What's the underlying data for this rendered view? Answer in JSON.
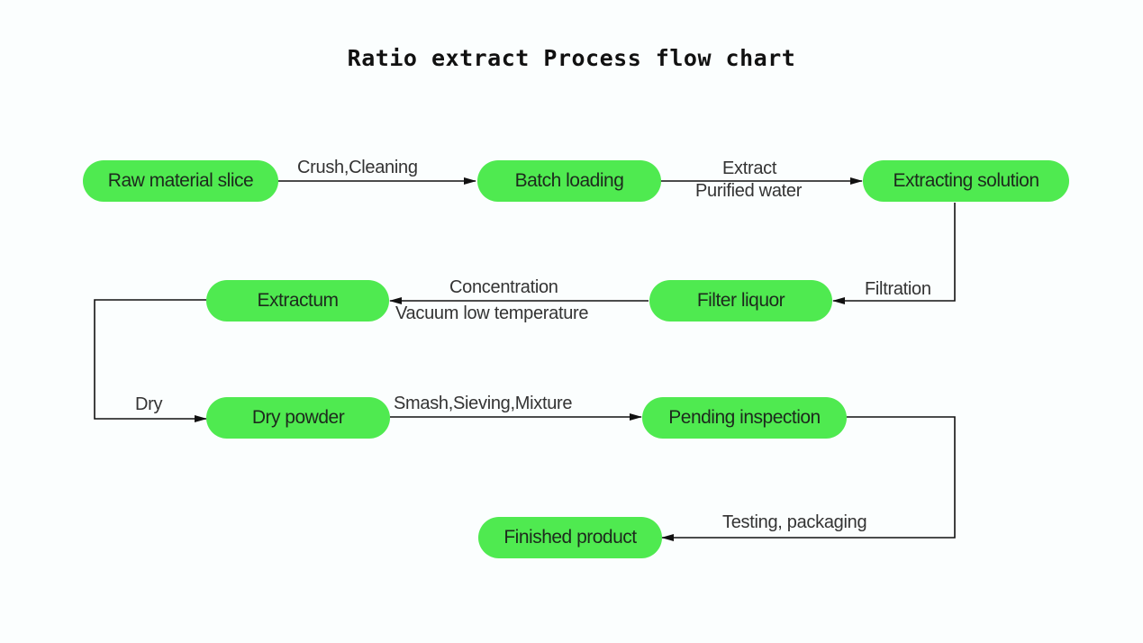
{
  "title": "Ratio extract Process flow chart",
  "colors": {
    "node_fill": "#4fea50",
    "line": "#111111",
    "background": "#fbfefe"
  },
  "nodes": [
    {
      "id": "raw",
      "label": "Raw material slice"
    },
    {
      "id": "batch",
      "label": "Batch loading"
    },
    {
      "id": "extracting",
      "label": "Extracting solution"
    },
    {
      "id": "filter",
      "label": "Filter liquor"
    },
    {
      "id": "extractum",
      "label": "Extractum"
    },
    {
      "id": "drypowder",
      "label": "Dry powder"
    },
    {
      "id": "pending",
      "label": "Pending inspection"
    },
    {
      "id": "finished",
      "label": "Finished product"
    }
  ],
  "edges": [
    {
      "from": "raw",
      "to": "batch",
      "label": "Crush,Cleaning"
    },
    {
      "from": "batch",
      "to": "extracting",
      "label_top": "Extract",
      "label_bottom": "Purified water"
    },
    {
      "from": "extracting",
      "to": "filter",
      "label": "Filtration"
    },
    {
      "from": "filter",
      "to": "extractum",
      "label_top": "Concentration",
      "label_bottom": "Vacuum low temperature"
    },
    {
      "from": "extractum",
      "to": "drypowder",
      "label": "Dry"
    },
    {
      "from": "drypowder",
      "to": "pending",
      "label": "Smash,Sieving,Mixture"
    },
    {
      "from": "pending",
      "to": "finished",
      "label": "Testing, packaging"
    }
  ]
}
